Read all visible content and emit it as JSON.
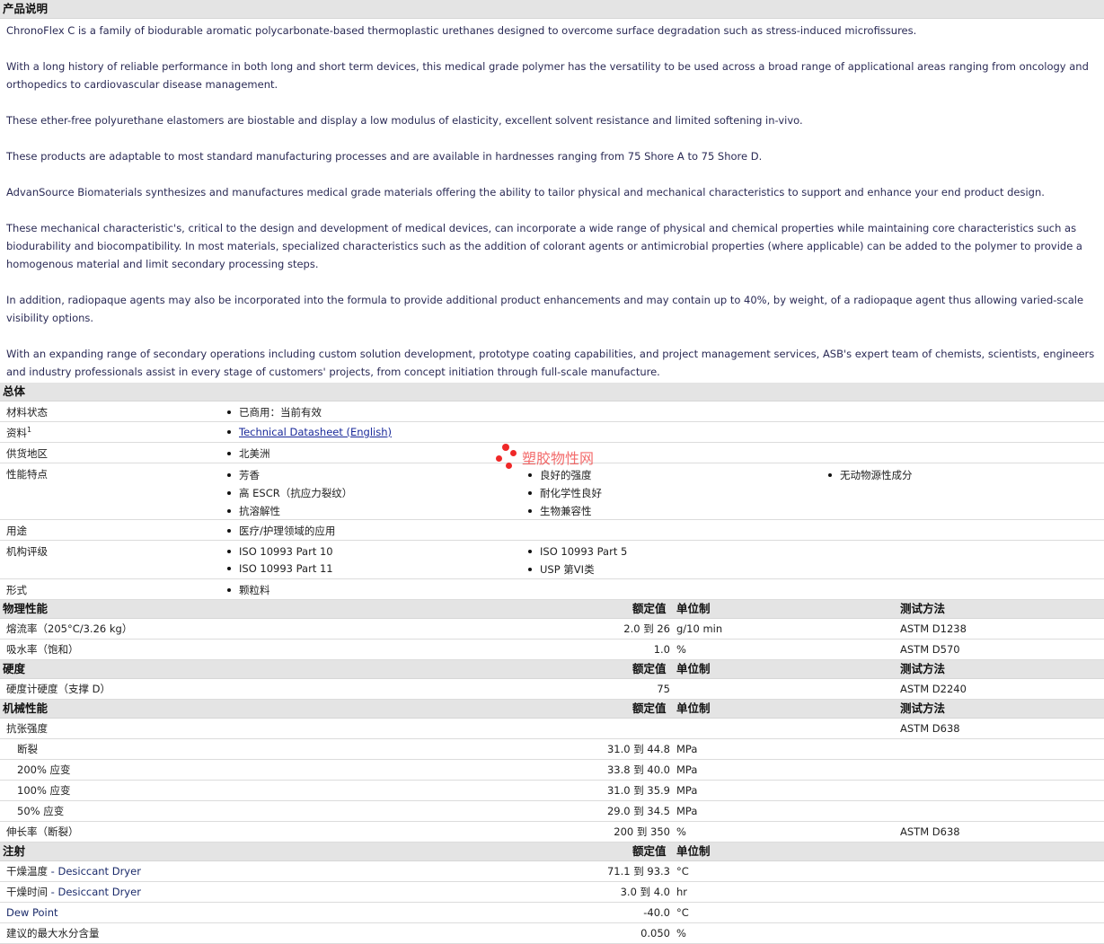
{
  "description": {
    "title": "产品说明",
    "paragraphs": [
      "ChronoFlex C is a family of biodurable aromatic polycarbonate-based thermoplastic urethanes designed to overcome surface degradation such as stress-induced microfissures.",
      "With a long history of reliable performance in both long and short term devices, this medical grade polymer has the versatility to be used across a broad range of applicational areas ranging from oncology and orthopedics to cardiovascular disease management.",
      "These ether-free polyurethane elastomers are biostable and display a low modulus of elasticity, excellent solvent resistance and limited softening in-vivo.",
      "These products are adaptable to most standard manufacturing processes and are available in hardnesses ranging from 75 Shore A to 75 Shore D.",
      "AdvanSource Biomaterials synthesizes and manufactures medical grade materials offering the ability to tailor physical and mechanical characteristics to support and enhance your end product design.",
      "These mechanical characteristic's, critical to the design and development of medical devices, can incorporate a wide range of physical and chemical properties while maintaining core characteristics such as biodurability and biocompatibility. In most materials, specialized characteristics such as the addition of colorant agents or antimicrobial properties (where applicable) can be added to the polymer to provide a homogenous material and limit secondary processing steps.",
      "In addition, radiopaque agents may also be incorporated into the formula to provide additional product enhancements and may contain up to 40%, by weight, of a radiopaque agent thus allowing varied-scale visibility options.",
      "With an expanding range of secondary operations including custom solution development, prototype coating capabilities, and project management services, ASB's expert team of chemists, scientists, engineers and industry professionals assist in every stage of customers' projects, from concept initiation through full-scale manufacture."
    ]
  },
  "general": {
    "title": "总体",
    "material_status": {
      "label": "材料状态",
      "value": "已商用：当前有效"
    },
    "docs": {
      "label": "资料",
      "sup": "1",
      "link": "Technical Datasheet (English)"
    },
    "region": {
      "label": "供货地区",
      "value": "北美洲"
    },
    "features": {
      "label": "性能特点",
      "items": [
        "芳香",
        "良好的强度",
        "无动物源性成分",
        "高 ESCR（抗应力裂纹）",
        "耐化学性良好",
        "抗溶解性",
        "生物兼容性"
      ]
    },
    "uses": {
      "label": "用途",
      "value": "医疗/护理领域的应用"
    },
    "agency": {
      "label": "机构评级",
      "items": [
        "ISO 10993 Part 10",
        "ISO 10993 Part 5",
        "ISO 10993 Part 11",
        "USP 第VI类"
      ]
    },
    "form": {
      "label": "形式",
      "value": "颗粒料"
    }
  },
  "headers": {
    "nominal": "额定值",
    "unit": "单位制",
    "method": "测试方法"
  },
  "physical": {
    "title": "物理性能",
    "rows": [
      {
        "label": "熔流率（205°C/3.26 kg）",
        "value": "2.0 到  26",
        "unit": "g/10 min",
        "method": "ASTM D1238"
      },
      {
        "label": "吸水率（饱和）",
        "value": "1.0",
        "unit": "%",
        "method": "ASTM D570"
      }
    ]
  },
  "hardness": {
    "title": "硬度",
    "rows": [
      {
        "label": "硬度计硬度（支撑 D）",
        "value": "75",
        "unit": "",
        "method": "ASTM D2240"
      }
    ]
  },
  "mechanical": {
    "title": "机械性能",
    "tensile": {
      "label": "抗张强度",
      "method": "ASTM D638"
    },
    "sub_rows": [
      {
        "label": "断裂",
        "value": "31.0 到  44.8",
        "unit": "MPa"
      },
      {
        "label": "200% 应变",
        "value": "33.8 到  40.0",
        "unit": "MPa"
      },
      {
        "label": "100% 应变",
        "value": "31.0 到  35.9",
        "unit": "MPa"
      },
      {
        "label": "50% 应变",
        "value": "29.0 到  34.5",
        "unit": "MPa"
      }
    ],
    "elongation": {
      "label": "伸长率（断裂）",
      "value": "200 到  350",
      "unit": "%",
      "method": "ASTM D638"
    }
  },
  "injection": {
    "title": "注射",
    "rows": [
      {
        "label": "干燥温度",
        "cond": " - Desiccant Dryer",
        "value": "71.1 到  93.3",
        "unit": "°C"
      },
      {
        "label": "干燥时间",
        "cond": " - Desiccant Dryer",
        "value": "3.0 到  4.0",
        "unit": "hr"
      },
      {
        "label": "Dew Point",
        "cond": "",
        "value": "-40.0",
        "unit": "°C"
      },
      {
        "label": "建议的最大水分含量",
        "cond": "",
        "value": "0.050",
        "unit": "%"
      }
    ]
  },
  "watermark": {
    "text": "塑胶物性网",
    "color": "#e11111"
  }
}
